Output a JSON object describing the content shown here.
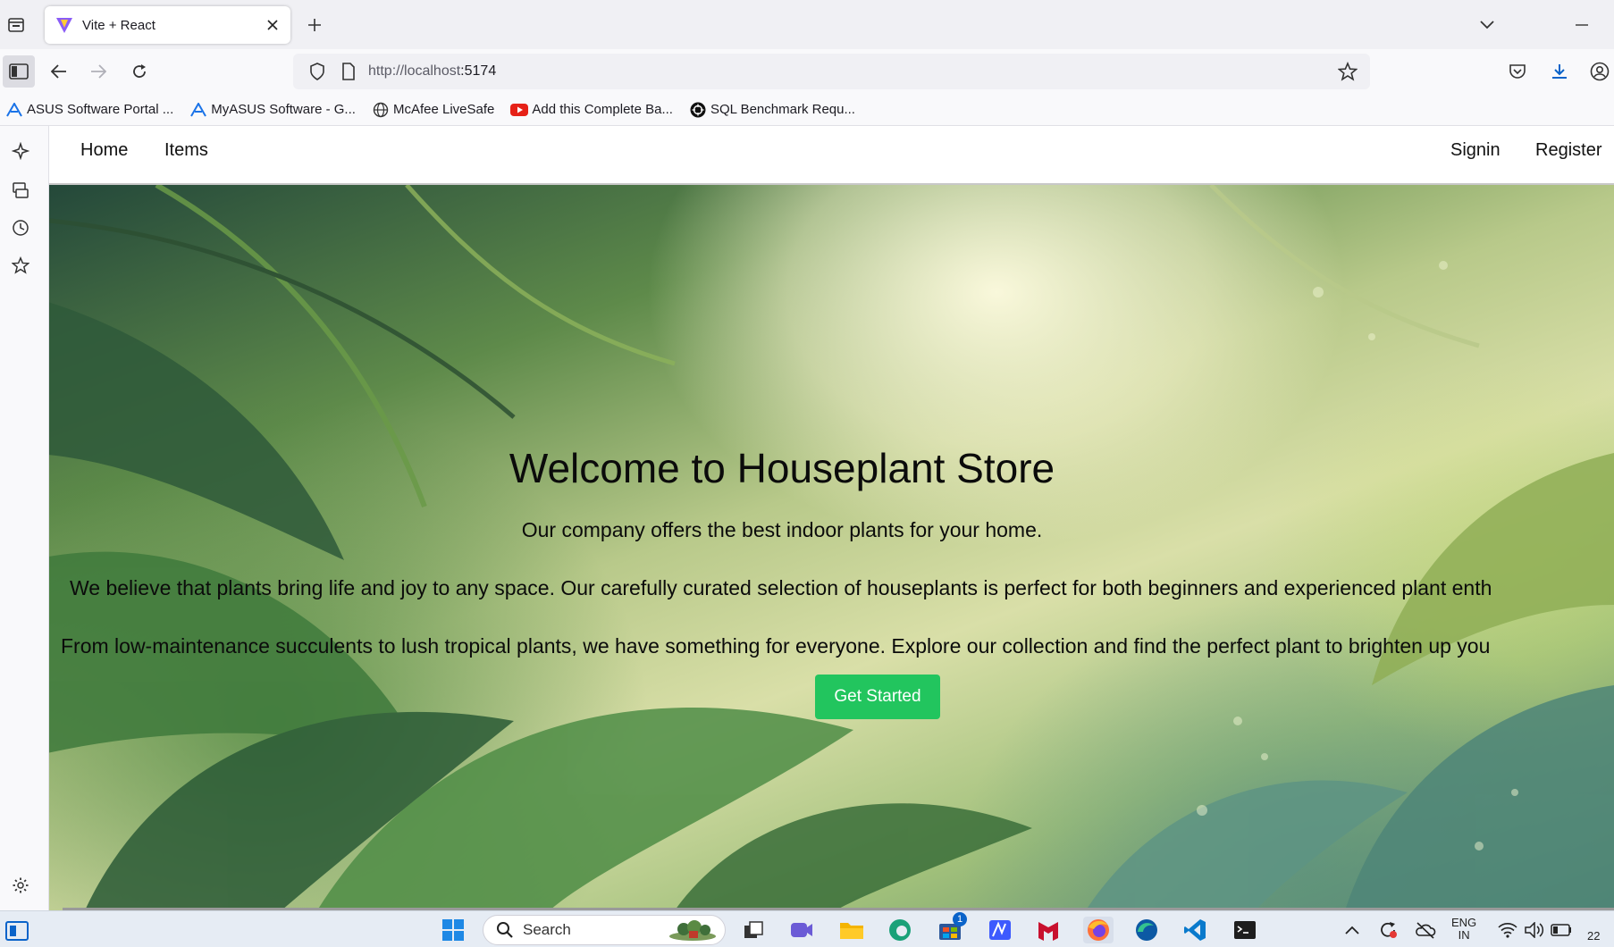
{
  "browser": {
    "tab": {
      "title": "Vite + React"
    },
    "url": {
      "scheme_host": "http://localhost",
      "port": ":5174"
    },
    "bookmarks": [
      {
        "label": "ASUS Software Portal ...",
        "icon": "asus-icon"
      },
      {
        "label": "MyASUS Software - G...",
        "icon": "asus-icon"
      },
      {
        "label": "McAfee LiveSafe",
        "icon": "globe-icon"
      },
      {
        "label": "Add this Complete Ba...",
        "icon": "youtube-icon"
      },
      {
        "label": "SQL Benchmark Requ...",
        "icon": "openai-icon"
      }
    ]
  },
  "site": {
    "nav": {
      "home": "Home",
      "items": "Items",
      "signin": "Signin",
      "register": "Register"
    },
    "hero": {
      "title": "Welcome to Houseplant Store",
      "subtitle": "Our company offers the best indoor plants for your home.",
      "paragraph1": "We believe that plants bring life and joy to any space. Our carefully curated selection of houseplants is perfect for both beginners and experienced plant enth",
      "paragraph2": "From low-maintenance succulents to lush tropical plants, we have something for everyone. Explore our collection and find the perfect plant to brighten up you",
      "cta": "Get Started"
    }
  },
  "taskbar": {
    "search_label": "Search",
    "store_badge": "1",
    "lang_line1": "ENG",
    "lang_line2": "IN",
    "clock_fragment": "22"
  },
  "colors": {
    "cta": "#22c55e",
    "accent_blue": "#0a63c9"
  }
}
